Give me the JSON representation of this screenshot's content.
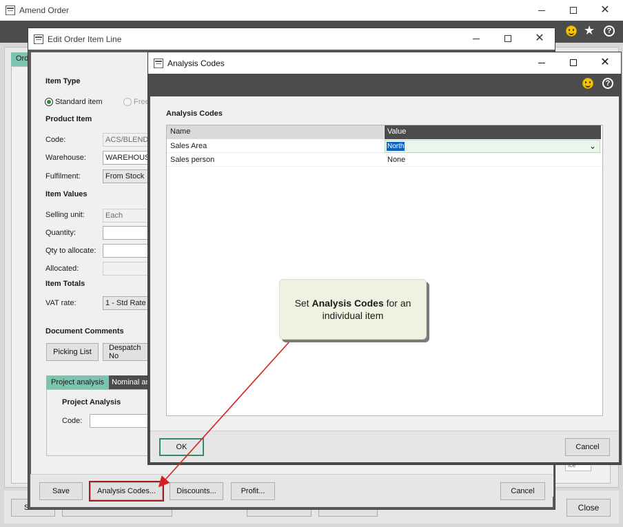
{
  "amend_order": {
    "title": "Amend Order",
    "tab_partial": "Ord",
    "close_label": "Close",
    "footer_partial_s": "S",
    "behind_text": "Co|ice"
  },
  "edit_line": {
    "title": "Edit Order Item Line",
    "item_type_heading": "Item Type",
    "radio_standard": "Standard item",
    "radio_free": "Free",
    "product_item_heading": "Product Item",
    "code_label": "Code:",
    "code_value": "ACS/BLENDE",
    "warehouse_label": "Warehouse:",
    "warehouse_value": "WAREHOUSE",
    "fulfilment_label": "Fulfilment:",
    "fulfilment_value": "From Stock",
    "item_values_heading": "Item Values",
    "selling_unit_label": "Selling unit:",
    "selling_unit_value": "Each",
    "quantity_label": "Quantity:",
    "qty_allocate_label": "Qty to allocate:",
    "allocated_label": "Allocated:",
    "item_totals_heading": "Item Totals",
    "vat_label": "VAT rate:",
    "vat_value": "1 - Std Rate",
    "doc_comments_heading": "Document Comments",
    "picking_list": "Picking List",
    "despatch": "Despatch No",
    "tab_project": "Project analysis",
    "tab_nominal": "Nominal ana",
    "project_analysis_heading": "Project Analysis",
    "project_code_label": "Code:",
    "buttons": {
      "save": "Save",
      "analysis_codes": "Analysis Codes...",
      "discounts": "Discounts...",
      "profit": "Profit...",
      "cancel": "Cancel"
    }
  },
  "analysis_dialog": {
    "title": "Analysis Codes",
    "heading": "Analysis Codes",
    "columns": [
      "Name",
      "Value"
    ],
    "rows": [
      {
        "name": "Sales Area",
        "value": "North"
      },
      {
        "name": "Sales person",
        "value": "None"
      }
    ],
    "ok": "OK",
    "cancel": "Cancel"
  },
  "callout": {
    "prefix": "Set ",
    "bold": "Analysis Codes",
    "suffix": " for an",
    "line2": "individual item"
  },
  "icons": [
    "smiley-icon",
    "star-icon",
    "help-icon",
    "chevron-down-icon",
    "window-icon"
  ],
  "colors": {
    "header_bar": "#4c4c4c",
    "tab_active": "#7cc4b0",
    "callout_bg": "#eef2e0",
    "highlight_box": "#a32020",
    "arrow": "#d42020",
    "ok_border": "#2e8b6d",
    "selection": "#0a64c8",
    "value_cell_bg": "#e9f6ea"
  }
}
